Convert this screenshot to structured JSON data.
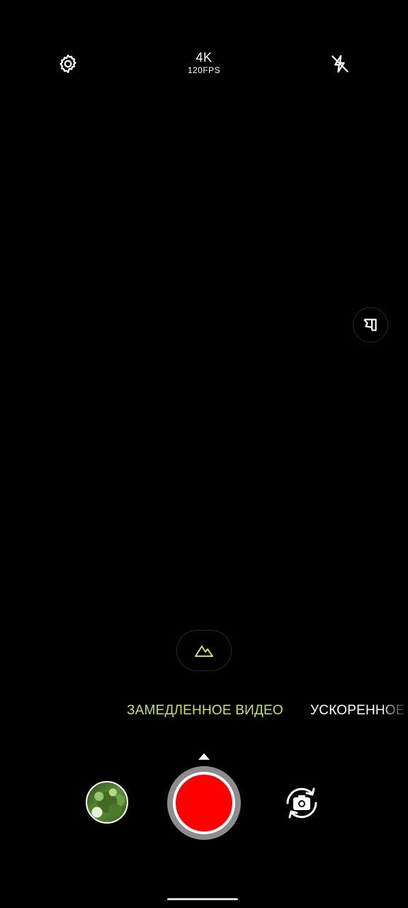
{
  "top_bar": {
    "settings_icon": "gear-icon",
    "resolution": "4K",
    "frame_rate": "120FPS",
    "flash_icon": "flash-off-icon"
  },
  "side": {
    "aspect_icon": "aspect-ratio-icon"
  },
  "scene": {
    "icon": "landscape-mountain-icon",
    "accent_color": "#c6e34f"
  },
  "modes": {
    "active": "ЗАМЕДЛЕННОЕ ВИДЕО",
    "next": "УСКОРЕННОЕ"
  },
  "controls": {
    "gallery_icon": "gallery-thumbnail",
    "shutter_color": "#ff0000",
    "switch_camera_icon": "switch-camera-icon",
    "expand_icon": "expand-up-arrow-icon"
  }
}
